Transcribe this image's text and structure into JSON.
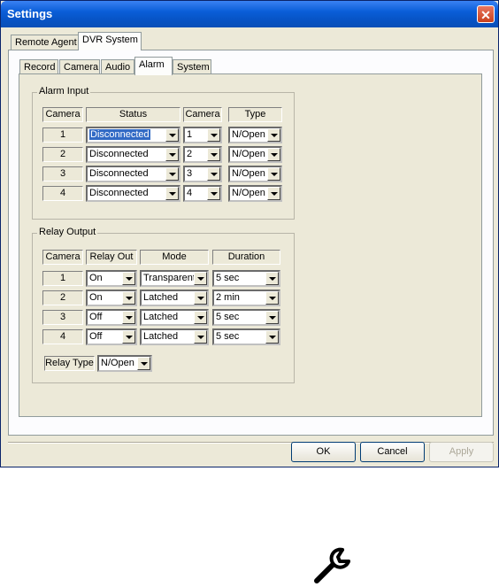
{
  "window": {
    "title": "Settings"
  },
  "top_tabs": [
    "Remote Agent",
    "DVR System"
  ],
  "sub_tabs": [
    "Record",
    "Camera",
    "Audio",
    "Alarm",
    "System"
  ],
  "alarm_input": {
    "title": "Alarm Input",
    "headers": {
      "camera": "Camera",
      "status": "Status",
      "camera2": "Camera",
      "type": "Type"
    },
    "rows": [
      {
        "num": "1",
        "status": "Disconnected",
        "camera": "1",
        "type": "N/Open"
      },
      {
        "num": "2",
        "status": "Disconnected",
        "camera": "2",
        "type": "N/Open"
      },
      {
        "num": "3",
        "status": "Disconnected",
        "camera": "3",
        "type": "N/Open"
      },
      {
        "num": "4",
        "status": "Disconnected",
        "camera": "4",
        "type": "N/Open"
      }
    ]
  },
  "relay_output": {
    "title": "Relay Output",
    "headers": {
      "camera": "Camera",
      "relay_out": "Relay Out",
      "mode": "Mode",
      "duration": "Duration"
    },
    "rows": [
      {
        "num": "1",
        "relay": "On",
        "mode": "Transparent",
        "duration": "5 sec"
      },
      {
        "num": "2",
        "relay": "On",
        "mode": "Latched",
        "duration": "2 min"
      },
      {
        "num": "3",
        "relay": "Off",
        "mode": "Latched",
        "duration": "5 sec"
      },
      {
        "num": "4",
        "relay": "Off",
        "mode": "Latched",
        "duration": "5 sec"
      }
    ],
    "relay_type_label": "Relay Type",
    "relay_type_value": "N/Open"
  },
  "buttons": {
    "ok": "OK",
    "cancel": "Cancel",
    "apply": "Apply"
  },
  "icons": {
    "close": "close-icon",
    "dropdown": "chevron-down-icon",
    "tool": "wrench-icon"
  }
}
